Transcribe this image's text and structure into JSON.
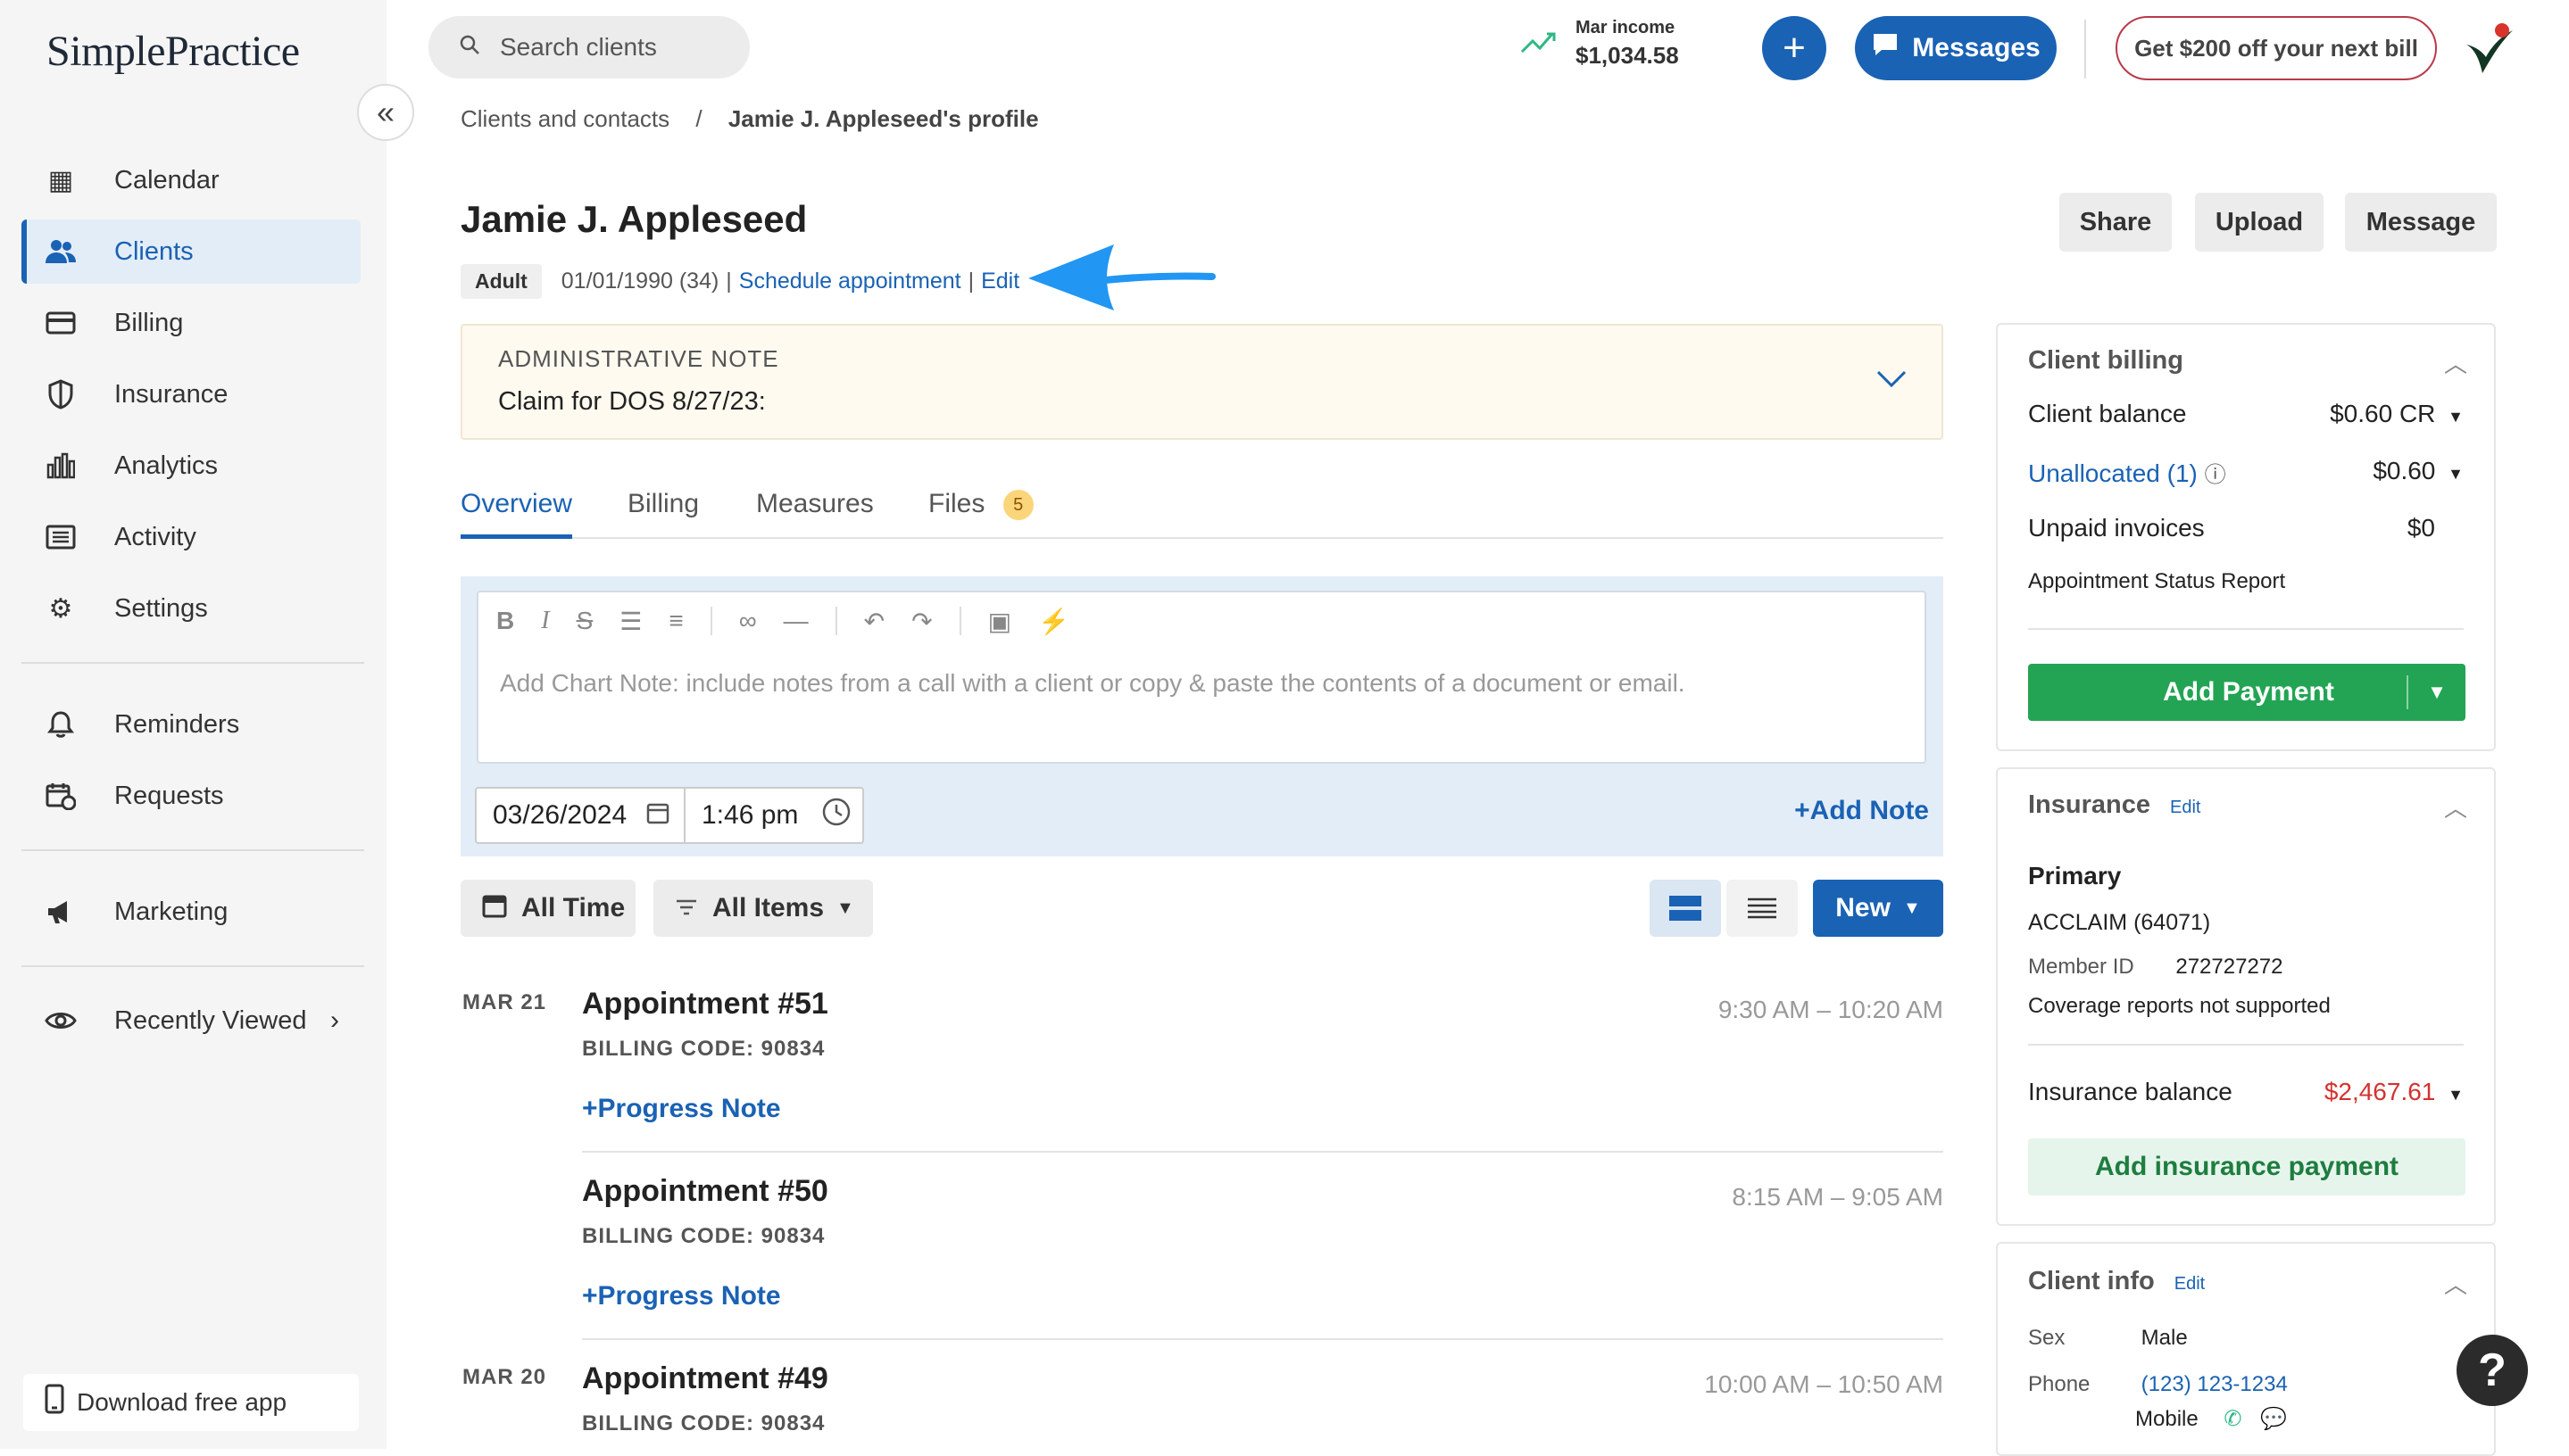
{
  "app": {
    "logo": "SimplePractice"
  },
  "sidebar": {
    "items": [
      {
        "label": "Calendar",
        "icon": "calendar-icon",
        "glyph": "▦"
      },
      {
        "label": "Clients",
        "icon": "clients-icon",
        "glyph": "👥"
      },
      {
        "label": "Billing",
        "icon": "billing-icon",
        "glyph": "▭"
      },
      {
        "label": "Insurance",
        "icon": "shield-icon",
        "glyph": "⛉"
      },
      {
        "label": "Analytics",
        "icon": "analytics-icon",
        "glyph": "▥"
      },
      {
        "label": "Activity",
        "icon": "activity-icon",
        "glyph": "▤"
      },
      {
        "label": "Settings",
        "icon": "gear-icon",
        "glyph": "⚙"
      },
      {
        "label": "Reminders",
        "icon": "bell-icon",
        "glyph": "🔔"
      },
      {
        "label": "Requests",
        "icon": "requests-icon",
        "glyph": "🗓"
      },
      {
        "label": "Marketing",
        "icon": "megaphone-icon",
        "glyph": "📣"
      },
      {
        "label": "Recently Viewed",
        "icon": "eye-icon",
        "glyph": "👁"
      }
    ],
    "download": "Download free app"
  },
  "topbar": {
    "search_placeholder": "Search clients",
    "income_label": "Mar income",
    "income_value": "$1,034.58",
    "messages": "Messages",
    "promo": "Get $200 off your next bill"
  },
  "breadcrumb": {
    "parent": "Clients and contacts",
    "sep": "/",
    "current": "Jamie J. Appleseed's profile"
  },
  "client": {
    "name": "Jamie J. Appleseed",
    "badge": "Adult",
    "dob": "01/01/1990 (34)",
    "pipe1": "|",
    "schedule": "Schedule appointment",
    "pipe2": "|",
    "edit": "Edit"
  },
  "header_buttons": {
    "share": "Share",
    "upload": "Upload",
    "message": "Message"
  },
  "admin_note": {
    "title": "ADMINISTRATIVE NOTE",
    "body": "Claim for DOS 8/27/23:"
  },
  "tabs": {
    "overview": "Overview",
    "billing": "Billing",
    "measures": "Measures",
    "files": "Files",
    "files_count": "5"
  },
  "note_editor": {
    "placeholder": "Add Chart Note: include notes from a call with a client or copy & paste the contents of a document or email.",
    "date": "03/26/2024",
    "time": "1:46 pm",
    "add_note": "Add Note"
  },
  "filters": {
    "time": "All Time",
    "items": "All Items",
    "new": "New"
  },
  "appointments": [
    {
      "date": "MAR 21",
      "title": "Appointment #51",
      "code": "BILLING CODE: 90834",
      "time": "9:30 AM – 10:20 AM",
      "note": "Progress Note"
    },
    {
      "date": "",
      "title": "Appointment #50",
      "code": "BILLING CODE: 90834",
      "time": "8:15 AM – 9:05 AM",
      "note": "Progress Note"
    },
    {
      "date": "MAR 20",
      "title": "Appointment #49",
      "code": "BILLING CODE: 90834",
      "time": "10:00 AM – 10:50 AM"
    }
  ],
  "billing_card": {
    "title": "Client billing",
    "client_balance_label": "Client balance",
    "client_balance_value": "$0.60 CR",
    "unallocated_label": "Unallocated (1)",
    "unallocated_value": "$0.60",
    "unpaid_label": "Unpaid invoices",
    "unpaid_value": "$0",
    "report_link": "Appointment Status Report",
    "add_payment": "Add Payment"
  },
  "insurance_card": {
    "title": "Insurance",
    "edit": "Edit",
    "primary": "Primary",
    "payer": "ACCLAIM (64071)",
    "member_label": "Member ID",
    "member_value": "272727272",
    "coverage": "Coverage reports not supported",
    "balance_label": "Insurance balance",
    "balance_value": "$2,467.61",
    "add_payment": "Add insurance payment"
  },
  "client_info_card": {
    "title": "Client info",
    "edit": "Edit",
    "sex_label": "Sex",
    "sex_value": "Male",
    "phone_label": "Phone",
    "phone_value": "(123) 123-1234",
    "phone_type": "Mobile"
  },
  "help": "?",
  "colors": {
    "brand_blue": "#1a62b4",
    "green": "#23a454",
    "red_balance": "#d3322f",
    "arrow": "#2196f3"
  }
}
